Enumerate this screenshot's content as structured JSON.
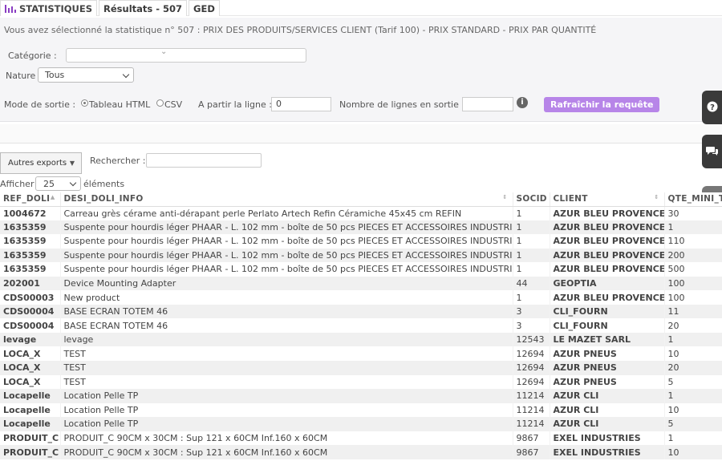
{
  "tabs": [
    {
      "label": "STATISTIQUES",
      "icon": "bar-chart-icon"
    },
    {
      "label": "Résultats - 507"
    },
    {
      "label": "GED"
    }
  ],
  "intro": "Vous avez sélectionné la statistique n° 507 : PRIX DES PRODUITS/SERVICES CLIENT (Tarif 100) - PRIX STANDARD - PRIX PAR QUANTITÉ",
  "form": {
    "category_label": "Catégorie :",
    "nature_label": "Nature",
    "nature_value": "Tous",
    "output_mode_label": "Mode de sortie :",
    "option_html": "Tableau HTML",
    "option_csv": "CSV",
    "from_line_label": "A partir la ligne :",
    "from_line_value": "0",
    "rows_label": "Nombre de lignes en sortie :",
    "rows_value": "",
    "info_symbol": "i",
    "refresh_label": "Rafraîchir la requête"
  },
  "toolbar": {
    "export_label": "Autres exports",
    "export_arrow": "▼",
    "search_label": "Rechercher :",
    "search_value": "",
    "show_label": "Afficher",
    "page_size": "25",
    "elements_label": "éléments"
  },
  "table": {
    "columns": [
      "REF_DOLI",
      "DESI_DOLI_INFO",
      "SOCID",
      "CLIENT",
      "QTE_MINI_T"
    ],
    "rows": [
      [
        "1004672",
        "Carreau grès cérame anti-dérapant perle Perlato Artech Refin Céramiche 45x45 cm REFIN",
        "1",
        "AZUR BLEU PROVENCE",
        "30"
      ],
      [
        "1635359",
        "Suspente pour hourdis léger PHAAR - L. 102 mm - boîte de 50 pcs PIECES ET ACCESSOIRES INDUSTRIELS",
        "1",
        "AZUR BLEU PROVENCE",
        "1"
      ],
      [
        "1635359",
        "Suspente pour hourdis léger PHAAR - L. 102 mm - boîte de 50 pcs PIECES ET ACCESSOIRES INDUSTRIELS",
        "1",
        "AZUR BLEU PROVENCE",
        "110"
      ],
      [
        "1635359",
        "Suspente pour hourdis léger PHAAR - L. 102 mm - boîte de 50 pcs PIECES ET ACCESSOIRES INDUSTRIELS",
        "1",
        "AZUR BLEU PROVENCE",
        "200"
      ],
      [
        "1635359",
        "Suspente pour hourdis léger PHAAR - L. 102 mm - boîte de 50 pcs PIECES ET ACCESSOIRES INDUSTRIELS",
        "1",
        "AZUR BLEU PROVENCE",
        "500"
      ],
      [
        "202001",
        "Device Mounting Adapter",
        "44",
        "GEOPTIA",
        "100"
      ],
      [
        "CDS00003",
        "New product",
        "1",
        "AZUR BLEU PROVENCE",
        "100"
      ],
      [
        "CDS00004",
        "BASE ECRAN TOTEM 46",
        "3",
        "CLI_FOURN",
        "11"
      ],
      [
        "CDS00004",
        "BASE ECRAN TOTEM 46",
        "3",
        "CLI_FOURN",
        "20"
      ],
      [
        "levage",
        "levage",
        "12543",
        "LE MAZET SARL",
        "1"
      ],
      [
        "LOCA_X",
        "TEST",
        "12694",
        "AZUR PNEUS",
        "10"
      ],
      [
        "LOCA_X",
        "TEST",
        "12694",
        "AZUR PNEUS",
        "20"
      ],
      [
        "LOCA_X",
        "TEST",
        "12694",
        "AZUR PNEUS",
        "5"
      ],
      [
        "Locapelle",
        "Location Pelle TP",
        "11214",
        "AZUR CLI",
        "1"
      ],
      [
        "Locapelle",
        "Location Pelle TP",
        "11214",
        "AZUR CLI",
        "10"
      ],
      [
        "Locapelle",
        "Location Pelle TP",
        "11214",
        "AZUR CLI",
        "5"
      ],
      [
        "PRODUIT_C",
        "PRODUIT_C 90CM x 30CM : Sup 121 x 60CM Inf.160 x 60CM",
        "9867",
        "EXEL INDUSTRIES",
        "1"
      ],
      [
        "PRODUIT_C",
        "PRODUIT_C 90CM x 30CM : Sup 121 x 60CM Inf.160 x 60CM",
        "9867",
        "EXEL INDUSTRIES",
        "10"
      ]
    ]
  },
  "side": {
    "help_icon": "question-icon",
    "chat_icon": "chat-icon",
    "calendar_icon": "calendar-check-icon"
  },
  "colors": {
    "accent": "#b785e8",
    "brand_icon": "#8a3ec2",
    "side_buttons": "#3a3a3a"
  }
}
